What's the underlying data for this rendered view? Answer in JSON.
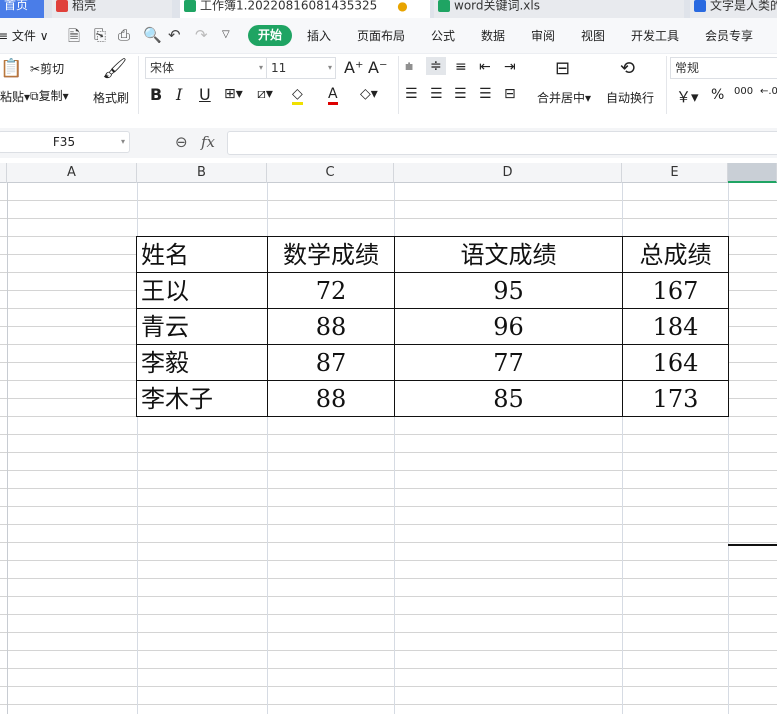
{
  "tabs": [
    {
      "label": "首页",
      "color": "#4a7de8"
    },
    {
      "label": "稻壳",
      "color": "#e0413b"
    },
    {
      "label": "工作簿1.20220816081435325",
      "color": "#1fa463"
    },
    {
      "label": "word关键词.xls",
      "color": "#1fa463"
    },
    {
      "label": "文字是人类的",
      "color": "#2a6ae0"
    }
  ],
  "menu": {
    "file": "文件",
    "start": "开始",
    "items": [
      "插入",
      "页面布局",
      "公式",
      "数据",
      "审阅",
      "视图",
      "开发工具",
      "会员专享"
    ]
  },
  "ribbon": {
    "cut": "剪切",
    "paste": "粘贴",
    "copy": "复制",
    "format_painter": "格式刷",
    "font": "宋体",
    "size": "11",
    "merge": "合并居中",
    "wrap": "自动换行",
    "number_format": "常规",
    "currency": "￥",
    "percent": "%",
    "thousands": "000"
  },
  "formula": {
    "cell": "F35",
    "fx": "fx",
    "value": ""
  },
  "columns": [
    "A",
    "B",
    "C",
    "D",
    "E"
  ],
  "table": {
    "headers": [
      "姓名",
      "数学成绩",
      "语文成绩",
      "总成绩"
    ],
    "rows": [
      [
        "王以",
        "72",
        "95",
        "167"
      ],
      [
        "青云",
        "88",
        "96",
        "184"
      ],
      [
        "李毅",
        "87",
        "77",
        "164"
      ],
      [
        "李木子",
        "88",
        "85",
        "173"
      ]
    ]
  }
}
